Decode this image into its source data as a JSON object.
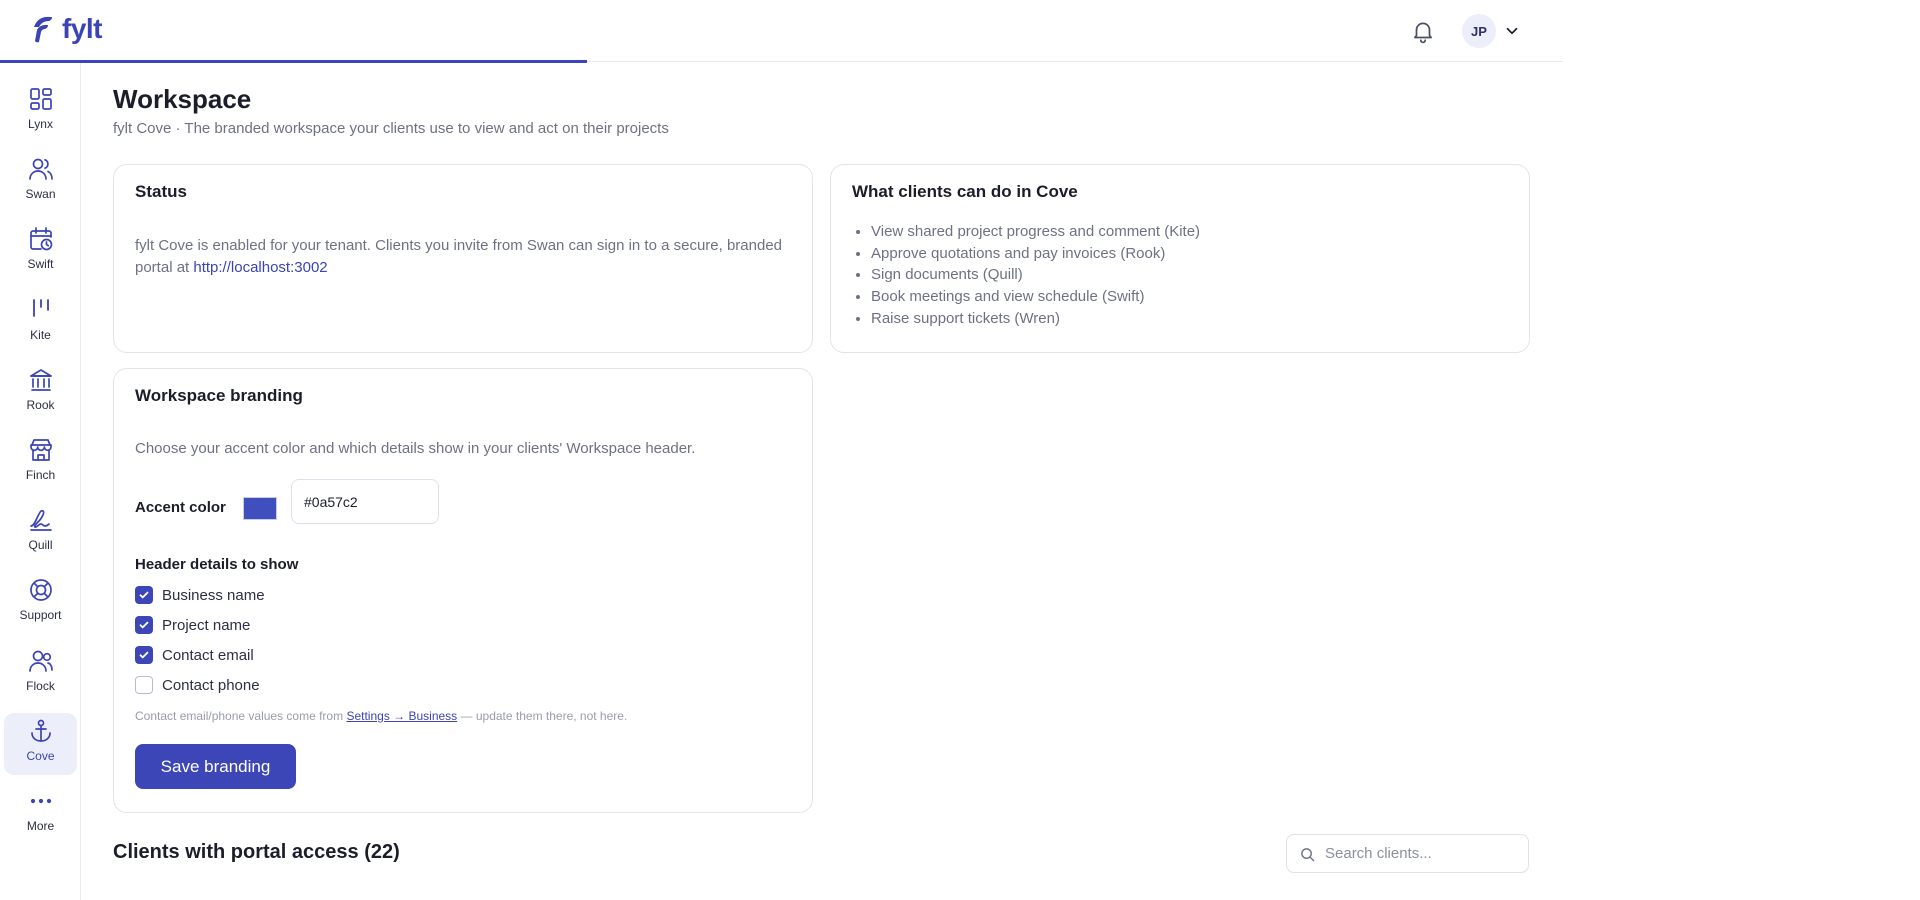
{
  "brand": {
    "name": "fylt",
    "color": "#3b44b5"
  },
  "header": {
    "avatar_initials": "JP"
  },
  "sidebar": {
    "items": [
      {
        "label": "Lynx",
        "icon": "grid-icon"
      },
      {
        "label": "Swan",
        "icon": "users-icon"
      },
      {
        "label": "Swift",
        "icon": "calendar-clock-icon"
      },
      {
        "label": "Kite",
        "icon": "pins-icon"
      },
      {
        "label": "Rook",
        "icon": "bank-icon"
      },
      {
        "label": "Finch",
        "icon": "store-icon"
      },
      {
        "label": "Quill",
        "icon": "signature-icon"
      },
      {
        "label": "Support",
        "icon": "lifebuoy-icon"
      },
      {
        "label": "Flock",
        "icon": "people-icon"
      },
      {
        "label": "Cove",
        "icon": "anchor-icon",
        "active": true
      },
      {
        "label": "More",
        "icon": "ellipsis-icon"
      }
    ]
  },
  "page": {
    "title": "Workspace",
    "subtitle": "fylt Cove · The branded workspace your clients use to view and act on their projects"
  },
  "status_card": {
    "title": "Status",
    "text": "fylt Cove is enabled for your tenant. Clients you invite from Swan can sign in to a secure, branded portal at",
    "link": "http://localhost:3002"
  },
  "capabilities_card": {
    "title": "What clients can do in Cove",
    "items": [
      "View shared project progress and comment (Kite)",
      "Approve quotations and pay invoices (Rook)",
      "Sign documents (Quill)",
      "Book meetings and view schedule (Swift)",
      "Raise support tickets (Wren)"
    ]
  },
  "branding_card": {
    "title": "Workspace branding",
    "description": "Choose your accent color and which details show in your clients' Workspace header.",
    "accent_label": "Accent color",
    "accent_value": "#0a57c2",
    "header_details_label": "Header details to show",
    "options": [
      {
        "label": "Business name",
        "checked": true
      },
      {
        "label": "Project name",
        "checked": true
      },
      {
        "label": "Contact email",
        "checked": true
      },
      {
        "label": "Contact phone",
        "checked": false
      }
    ],
    "note_prefix": "Contact email/phone values come from",
    "note_link": "Settings → Business",
    "note_suffix": "— update them there, not here.",
    "save_label": "Save branding"
  },
  "clients": {
    "title": "Clients with portal access (22)",
    "search_placeholder": "Search clients..."
  },
  "colors": {
    "accent": "#3d46b7",
    "muted_text": "#6e7185",
    "border": "#e3e4ec"
  }
}
